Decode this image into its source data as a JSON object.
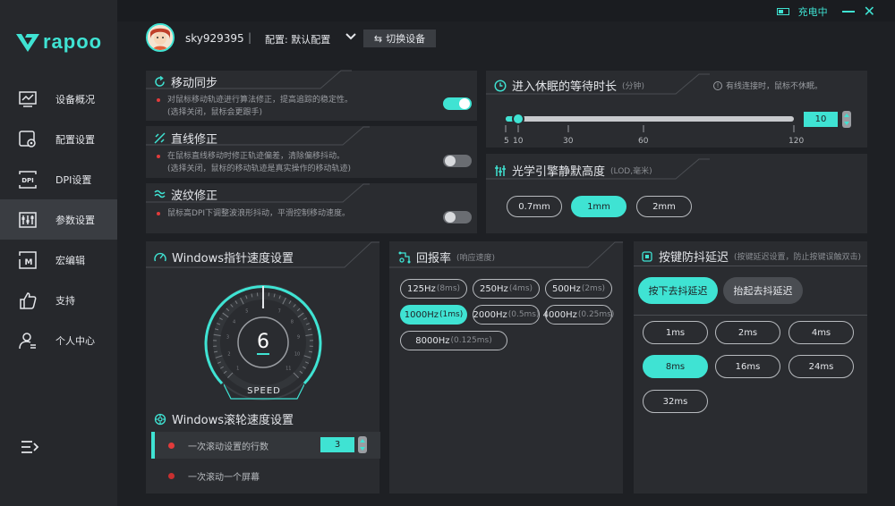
{
  "brand": {
    "name": "rapoo"
  },
  "status": {
    "label": "充电中"
  },
  "user": {
    "name": "sky929395",
    "separator": "|",
    "config": "配置: 默认配置",
    "switch_label": "切换设备"
  },
  "nav": [
    {
      "label": "设备概况",
      "icon": "monitor-chart-icon"
    },
    {
      "label": "配置设置",
      "icon": "config-gear-icon"
    },
    {
      "label": "DPI设置",
      "icon": "dpi-icon"
    },
    {
      "label": "参数设置",
      "icon": "sliders-icon"
    },
    {
      "label": "宏编辑",
      "icon": "macro-icon"
    },
    {
      "label": "支持",
      "icon": "thumbs-up-icon"
    },
    {
      "label": "个人中心",
      "icon": "user-icon"
    }
  ],
  "move_sync": {
    "title": "移动同步",
    "desc1": "对鼠标移动轨迹进行算法修正，提高追踪的稳定性。",
    "desc2": "(选择关闭，鼠标会更跟手)",
    "enabled": true
  },
  "line_fix": {
    "title": "直线修正",
    "desc1": "在鼠标直线移动时修正轨迹偏差，清除偏移抖动。",
    "desc2": "(选择关闭，鼠标的移动轨迹是真实操作的移动轨迹)",
    "enabled": false
  },
  "ripple_fix": {
    "title": "波纹修正",
    "desc1": "鼠标高DPI下调整波浪形抖动，平滑控制移动速度。",
    "enabled": false
  },
  "sleep": {
    "title": "进入休眠的等待时长",
    "unit": "(分钟)",
    "note": "有线连接时，鼠标不休眠。",
    "value": 10,
    "min": 5,
    "max": 120,
    "ticks": [
      "5",
      "10",
      "30",
      "60",
      "120"
    ]
  },
  "lod": {
    "title": "光学引擎静默高度",
    "unit": "(LOD,毫米)",
    "options": [
      "0.7mm",
      "1mm",
      "2mm"
    ],
    "selected": 1
  },
  "pointer": {
    "title": "Windows指针速度设置",
    "value": "6",
    "speed_label": "SPEED",
    "scale": [
      "1",
      "2",
      "3",
      "4",
      "5",
      "6",
      "7",
      "8",
      "9",
      "10",
      "11"
    ]
  },
  "scroll": {
    "title": "Windows滚轮速度设置",
    "option1": "一次滚动设置的行数",
    "option2": "一次滚动一个屏幕",
    "lines": "3"
  },
  "polling": {
    "title": "回报率",
    "sub": "(响应速度)",
    "options": [
      {
        "main": "125Hz",
        "sub": "(8ms)"
      },
      {
        "main": "250Hz",
        "sub": "(4ms)"
      },
      {
        "main": "500Hz",
        "sub": "(2ms)"
      },
      {
        "main": "1000Hz",
        "sub": "(1ms)"
      },
      {
        "main": "2000Hz",
        "sub": "(0.5ms)"
      },
      {
        "main": "4000Hz",
        "sub": "(0.25ms)"
      },
      {
        "main": "8000Hz",
        "sub": "(0.125ms)"
      }
    ],
    "selected": 3
  },
  "debounce": {
    "title": "按键防抖延迟",
    "sub": "(按键延迟设置，防止按键误触双击)",
    "press": "按下去抖延迟",
    "release": "抬起去抖延迟",
    "options": [
      "1ms",
      "2ms",
      "4ms",
      "8ms",
      "16ms",
      "24ms",
      "32ms"
    ],
    "selected": 3
  },
  "colors": {
    "accent": "#3fe3d3",
    "bg": "#1e2024",
    "panel": "#2a2c30",
    "dot": "#e23b3b"
  }
}
